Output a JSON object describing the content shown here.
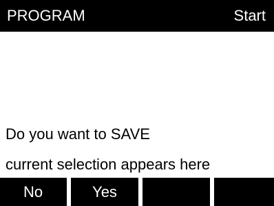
{
  "header": {
    "title": "PROGRAM",
    "status": "Start"
  },
  "message": {
    "line1": "Do you want to SAVE",
    "line2": "current selection appears here"
  },
  "softkeys": [
    {
      "label": "No"
    },
    {
      "label": "Yes"
    },
    {
      "label": ""
    },
    {
      "label": ""
    }
  ],
  "colors": {
    "background": "#ffffff",
    "bar": "#000000",
    "bar_text": "#ffffff",
    "text": "#000000"
  }
}
